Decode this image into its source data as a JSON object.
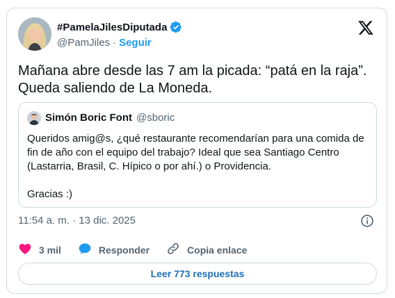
{
  "author": {
    "display_name": "#PamelaJilesDiputada",
    "handle": "@PamJiles",
    "separator": "·",
    "follow_label": "Seguir",
    "verified": true
  },
  "tweet": {
    "line1": "Mañana abre desde las 7 am la picada: “patá en la raja”.",
    "line2": "Queda saliendo de La Moneda."
  },
  "quote": {
    "display_name": "Simón Boric Font",
    "handle": "@sboric",
    "lines": [
      "Queridos amig@s, ¿qué restaurante recomendarían para una comida de",
      "fin de año con el equipo del trabajo? Ideal que sea Santiago Centro",
      "(Lastarria, Brasil, C. Hípico o por ahí.) o Providencia."
    ],
    "closing": "Gracias :)"
  },
  "timestamp": "11:54 a. m. · 13 dic. 2025",
  "actions": {
    "likes": "3 mil",
    "reply": "Responder",
    "copy_link": "Copia enlace"
  },
  "read_replies": "Leer 773 respuestas",
  "colors": {
    "accent": "#1d9bf0",
    "like": "#f91880",
    "text": "#0f1419",
    "muted": "#536471",
    "border": "#cfd9de"
  },
  "icons": [
    "verified-badge-icon",
    "x-logo-icon",
    "info-icon",
    "heart-icon",
    "reply-bubble-icon",
    "link-icon"
  ]
}
